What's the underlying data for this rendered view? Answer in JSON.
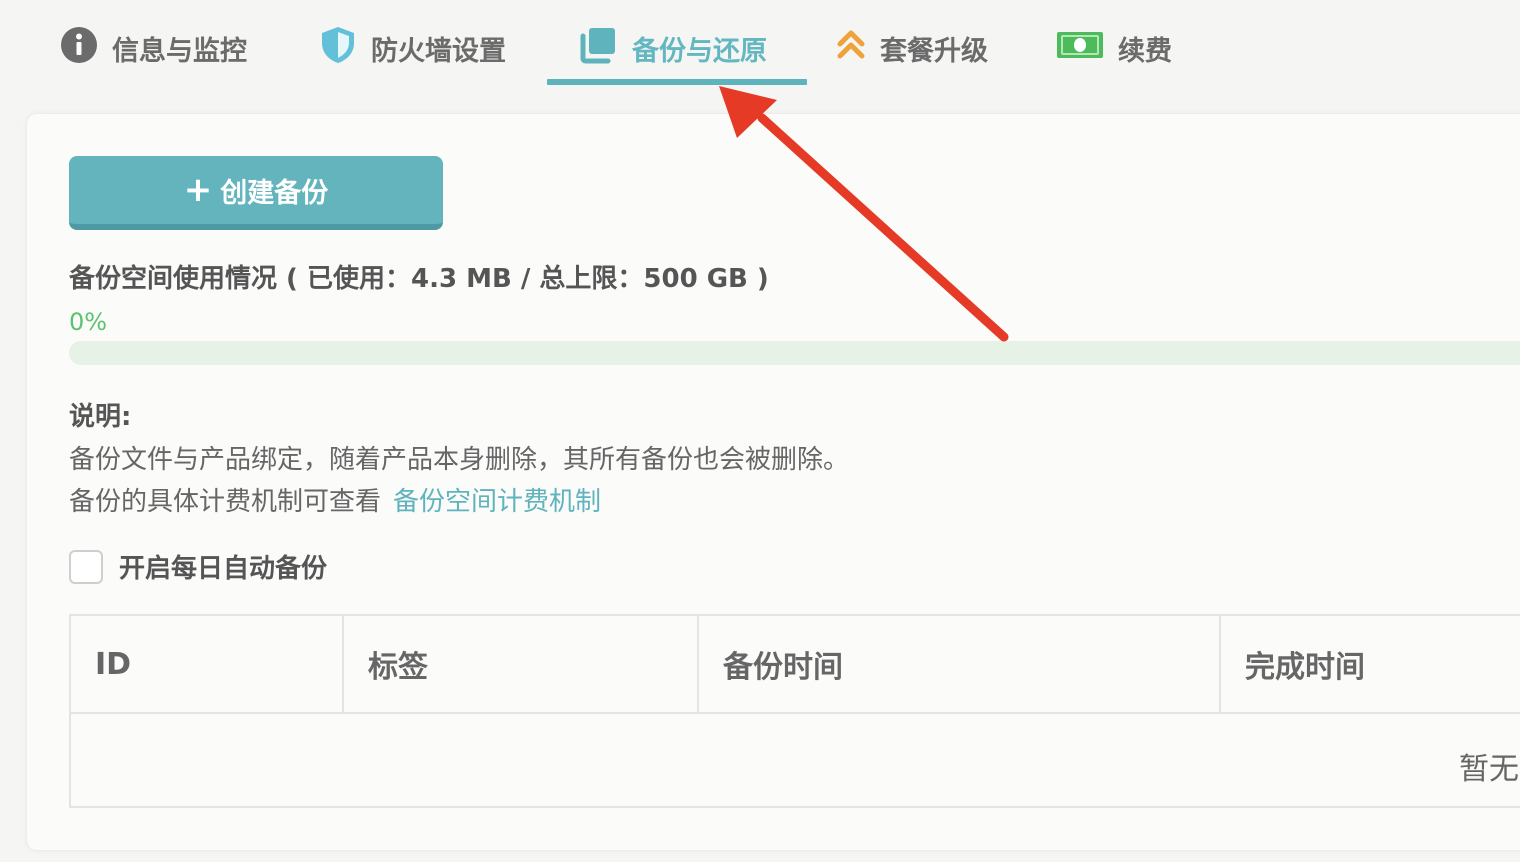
{
  "tabs": [
    {
      "label": "信息与监控",
      "icon": "info-icon"
    },
    {
      "label": "防火墙设置",
      "icon": "shield-icon"
    },
    {
      "label": "备份与还原",
      "icon": "copy-icon",
      "active": true
    },
    {
      "label": "套餐升级",
      "icon": "double-chevron-up-icon"
    },
    {
      "label": "续费",
      "icon": "money-icon"
    }
  ],
  "colors": {
    "accent": "#5fb3bd",
    "progress": "#5cc270",
    "arrow": "#e53a26",
    "upgrade": "#f0a23a",
    "money": "#4cbb5a"
  },
  "backup": {
    "create_label": "创建备份",
    "usage_text": "备份空间使用情况 ( 已使用：4.3 MB / 总上限：500 GB )",
    "percent_text": "0%",
    "percent_value": 0,
    "note_title": "说明:",
    "note_line1": "备份文件与产品绑定，随着产品本身删除，其所有备份也会被删除。",
    "note_line2_prefix": "备份的具体计费机制可查看",
    "note_link": "备份空间计费机制",
    "auto_backup_label": "开启每日自动备份",
    "auto_backup_checked": false
  },
  "table": {
    "headers": [
      "ID",
      "标签",
      "备份时间",
      "完成时间"
    ],
    "empty_text": "暂无"
  }
}
